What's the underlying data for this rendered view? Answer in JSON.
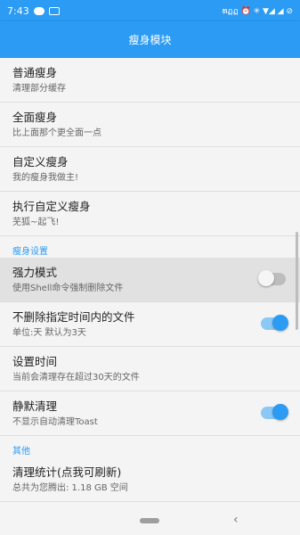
{
  "status": {
    "time": "7:43",
    "right_text": "ທฏฏ ⏰ ✳ ▼◢ ◢ ⊘"
  },
  "appbar": {
    "title": "瘦身模块"
  },
  "items_top": [
    {
      "title": "普通瘦身",
      "sub": "清理部分缓存"
    },
    {
      "title": "全面瘦身",
      "sub": "比上面那个更全面一点"
    },
    {
      "title": "自定义瘦身",
      "sub": "我的瘦身我做主!"
    },
    {
      "title": "执行自定义瘦身",
      "sub": "芜狐~起飞!"
    }
  ],
  "section_settings": "瘦身设置",
  "items_settings": [
    {
      "title": "强力模式",
      "sub": "使用Shell命令强制删除文件",
      "switch": "off"
    },
    {
      "title": "不删除指定时间内的文件",
      "sub": "单位:天 默认为3天",
      "switch": "on"
    },
    {
      "title": "设置时间",
      "sub": "当前会清理存在超过30天的文件"
    },
    {
      "title": "静默清理",
      "sub": "不显示自动清理Toast",
      "switch": "on"
    }
  ],
  "section_other": "其他",
  "items_other": [
    {
      "title": "清理统计(点我可刷新)",
      "sub": "总共为您腾出: 1.18 GB 空间"
    }
  ],
  "colors": {
    "accent": "#2b9bf4",
    "background": "#f4f4f4"
  }
}
